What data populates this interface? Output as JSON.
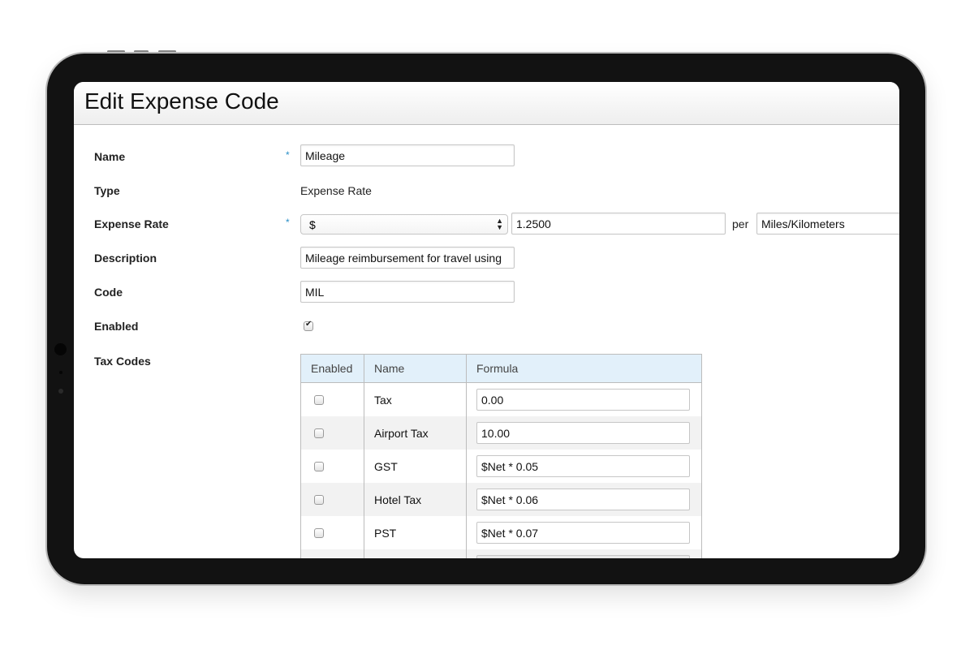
{
  "page": {
    "title": "Edit Expense Code"
  },
  "form": {
    "name": {
      "label": "Name",
      "required": true,
      "value": "Mileage"
    },
    "type": {
      "label": "Type",
      "value": "Expense Rate"
    },
    "expense_rate": {
      "label": "Expense Rate",
      "required": true,
      "currency": "$",
      "rate": "1.2500",
      "per_label": "per",
      "unit": "Miles/Kilometers"
    },
    "description": {
      "label": "Description",
      "value": "Mileage reimbursement for travel using"
    },
    "code": {
      "label": "Code",
      "value": "MIL"
    },
    "enabled": {
      "label": "Enabled",
      "checked": true
    },
    "tax_codes": {
      "label": "Tax Codes",
      "columns": [
        "Enabled",
        "Name",
        "Formula"
      ],
      "rows": [
        {
          "enabled": false,
          "name": "Tax",
          "formula": "0.00"
        },
        {
          "enabled": false,
          "name": "Airport Tax",
          "formula": "10.00"
        },
        {
          "enabled": false,
          "name": "GST",
          "formula": "$Net * 0.05"
        },
        {
          "enabled": false,
          "name": "Hotel Tax",
          "formula": "$Net * 0.06"
        },
        {
          "enabled": false,
          "name": "PST",
          "formula": "$Net * 0.07"
        }
      ]
    }
  },
  "required_marker": "*"
}
